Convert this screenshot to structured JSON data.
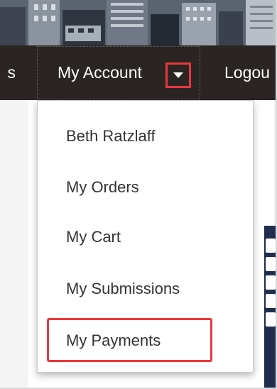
{
  "nav": {
    "cut_left_label": "s",
    "account_label": "My Account",
    "logout_label": "Logou"
  },
  "dropdown": {
    "items": [
      {
        "label": "Beth Ratzlaff"
      },
      {
        "label": "My Orders"
      },
      {
        "label": "My Cart"
      },
      {
        "label": "My Submissions"
      },
      {
        "label": "My Payments"
      }
    ]
  },
  "colors": {
    "navbar": "#2a2523",
    "highlight": "#e8383c",
    "dropdown_text": "#333333"
  }
}
